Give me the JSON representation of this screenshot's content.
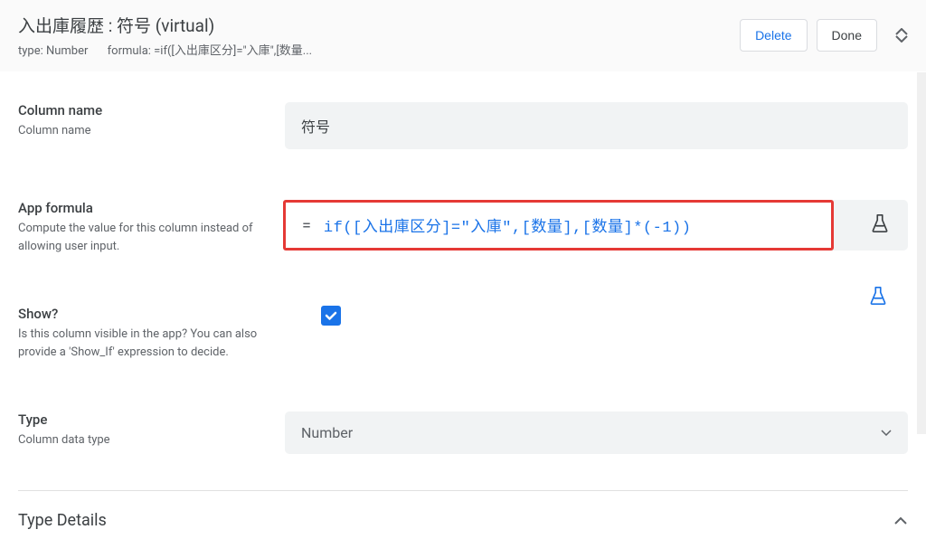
{
  "header": {
    "title": "入出庫履歴 : 符号 (virtual)",
    "type_label": "type: Number",
    "formula_label": "formula: =if([入出庫区分]=\"入庫\",[数量...",
    "delete_btn": "Delete",
    "done_btn": "Done"
  },
  "fields": {
    "column_name": {
      "title": "Column name",
      "desc": "Column name",
      "value": "符号"
    },
    "app_formula": {
      "title": "App formula",
      "desc": "Compute the value for this column instead of allowing user input.",
      "eq": "=",
      "expr": "if([入出庫区分]=\"入庫\",[数量],[数量]*(-1))"
    },
    "show": {
      "title": "Show?",
      "desc": "Is this column visible in the app? You can also provide a 'Show_If' expression to decide.",
      "checked": true
    },
    "type": {
      "title": "Type",
      "desc": "Column data type",
      "value": "Number"
    }
  },
  "section": {
    "type_details": "Type Details"
  }
}
